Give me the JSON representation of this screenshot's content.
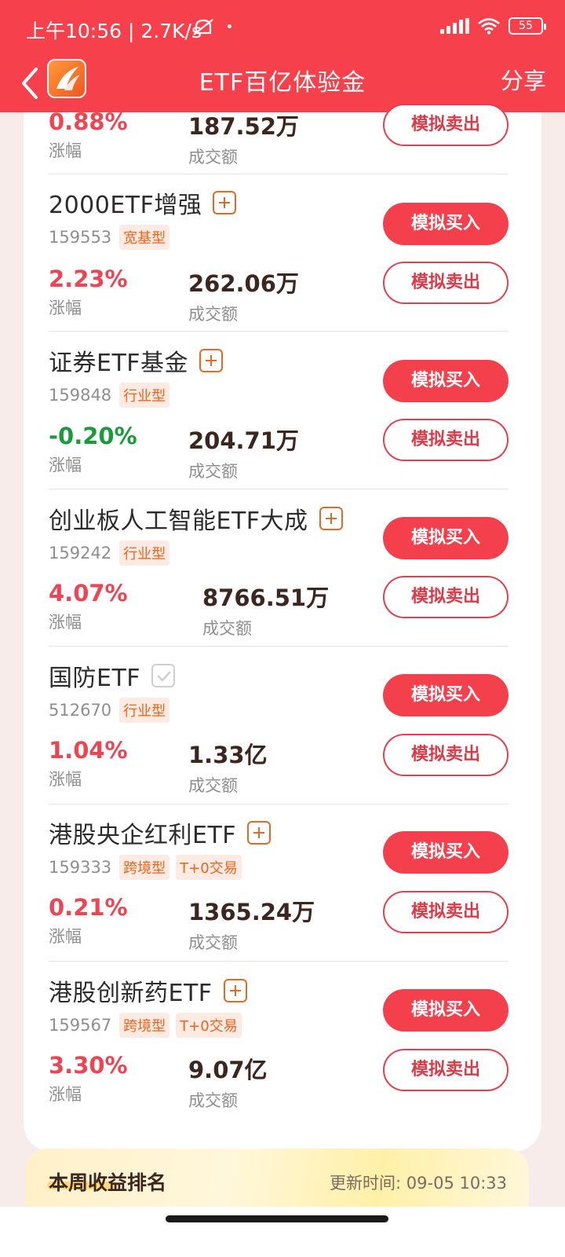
{
  "status_bar": {
    "text": "上午10:56 | 2.7K/s",
    "battery": "55"
  },
  "nav": {
    "title": "ETF百亿体验金",
    "share": "分享"
  },
  "labels": {
    "change": "涨幅",
    "volume": "成交额",
    "buy": "模拟买入",
    "sell": "模拟卖出"
  },
  "partial_row": {
    "change": "0.88%",
    "volume": "187.52万"
  },
  "funds": [
    {
      "name": "2000ETF增强",
      "code": "159553",
      "tags": [
        "宽基型"
      ],
      "change": "2.23%",
      "volume": "262.06万",
      "added": false
    },
    {
      "name": "证券ETF基金",
      "code": "159848",
      "tags": [
        "行业型"
      ],
      "change": "-0.20%",
      "volume": "204.71万",
      "added": false
    },
    {
      "name": "创业板人工智能ETF大成",
      "code": "159242",
      "tags": [
        "行业型"
      ],
      "change": "4.07%",
      "volume": "8766.51万",
      "added": false
    },
    {
      "name": "国防ETF",
      "code": "512670",
      "tags": [
        "行业型"
      ],
      "change": "1.04%",
      "volume": "1.33亿",
      "added": true
    },
    {
      "name": "港股央企红利ETF",
      "code": "159333",
      "tags": [
        "跨境型",
        "T+0交易"
      ],
      "change": "0.21%",
      "volume": "1365.24万",
      "added": false
    },
    {
      "name": "港股创新药ETF",
      "code": "159567",
      "tags": [
        "跨境型",
        "T+0交易"
      ],
      "change": "3.30%",
      "volume": "9.07亿",
      "added": false
    }
  ],
  "ranking": {
    "title": "本周收益排名",
    "update_time": "更新时间: 09-05 10:33"
  },
  "colors": {
    "brand_red": "#f6404b",
    "up": "#ec4553",
    "down": "#1a9a3c",
    "tag": "#e8651a"
  }
}
